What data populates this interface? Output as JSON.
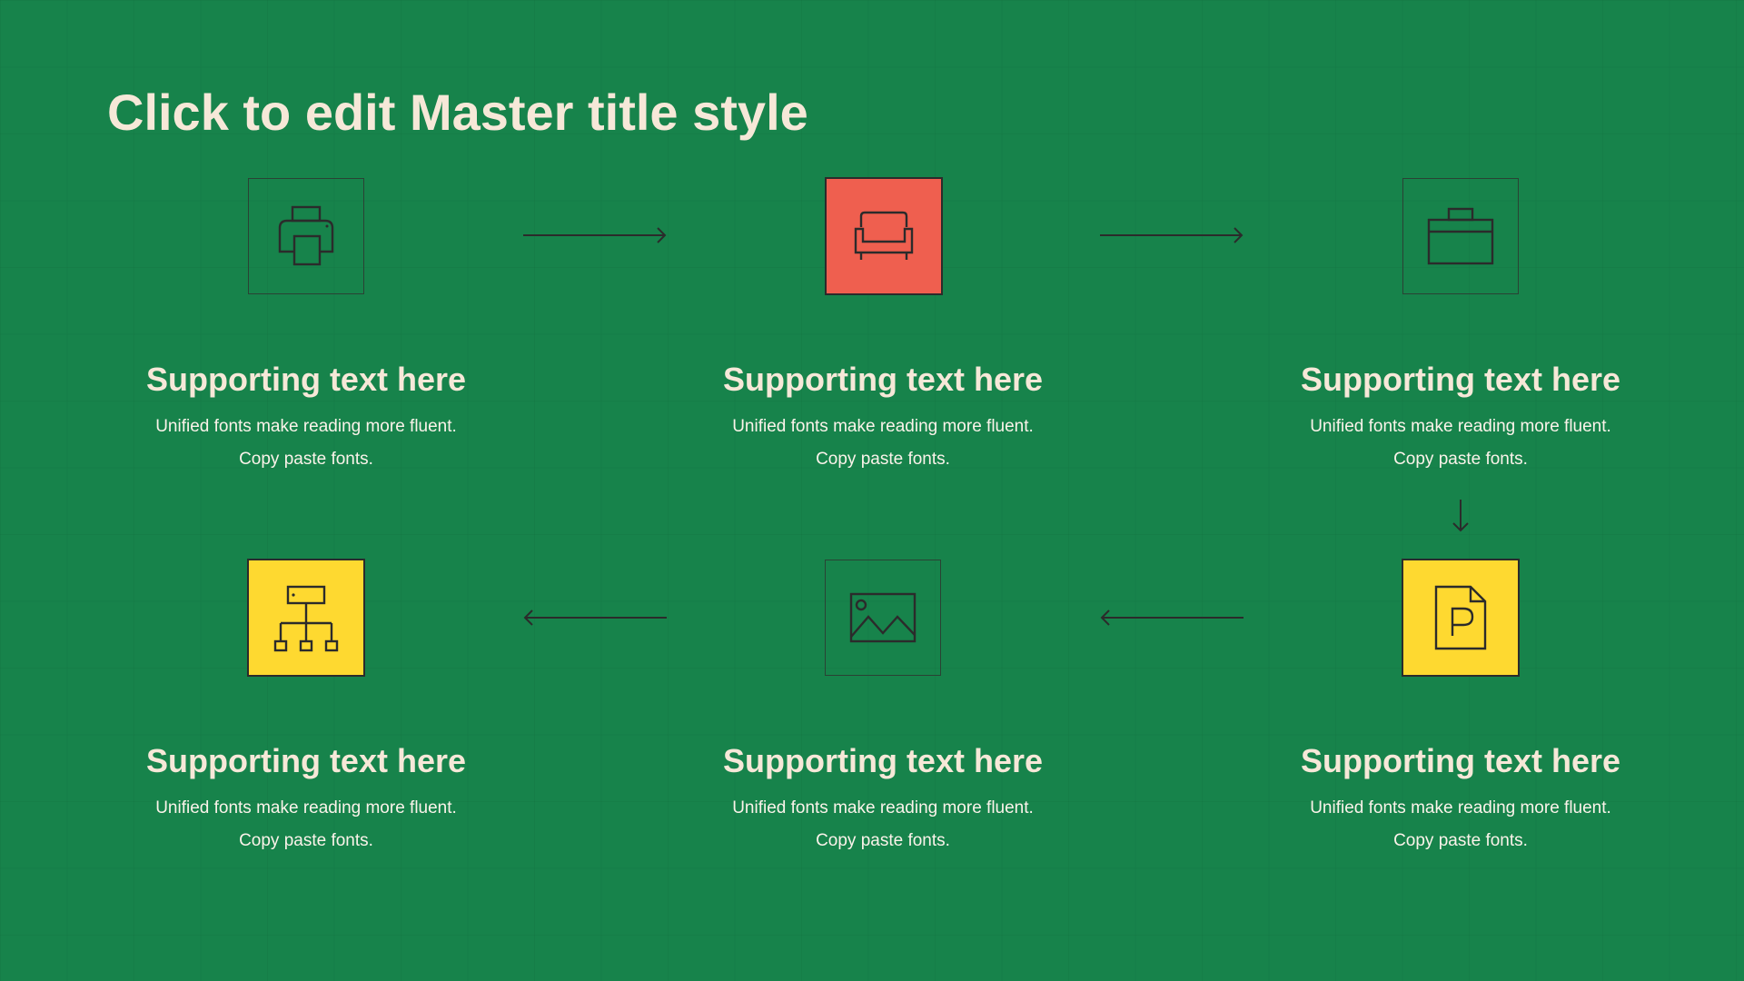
{
  "title": "Click to edit Master title style",
  "colors": {
    "background": "#17834b",
    "text": "#f6e8d8",
    "accent_red": "#ef5f4f",
    "accent_yellow": "#fed930",
    "line": "#2b2b2b"
  },
  "steps": [
    {
      "icon": "printer-icon",
      "heading": "Supporting text here",
      "line1": "Unified  fonts make reading more fluent.",
      "line2": "Copy paste fonts."
    },
    {
      "icon": "sofa-icon",
      "heading": "Supporting text here",
      "line1": "Unified  fonts make reading more fluent.",
      "line2": "Copy paste fonts."
    },
    {
      "icon": "briefcase-icon",
      "heading": "Supporting text here",
      "line1": "Unified  fonts make reading more fluent.",
      "line2": "Copy paste fonts."
    },
    {
      "icon": "org-chart-icon",
      "heading": "Supporting text here",
      "line1": "Unified  fonts make reading more fluent.",
      "line2": "Copy paste fonts."
    },
    {
      "icon": "image-icon",
      "heading": "Supporting text here",
      "line1": "Unified  fonts make reading more fluent.",
      "line2": "Copy paste fonts."
    },
    {
      "icon": "powerpoint-file-icon",
      "heading": "Supporting text here",
      "line1": "Unified  fonts make reading more fluent.",
      "line2": "Copy paste fonts."
    }
  ]
}
